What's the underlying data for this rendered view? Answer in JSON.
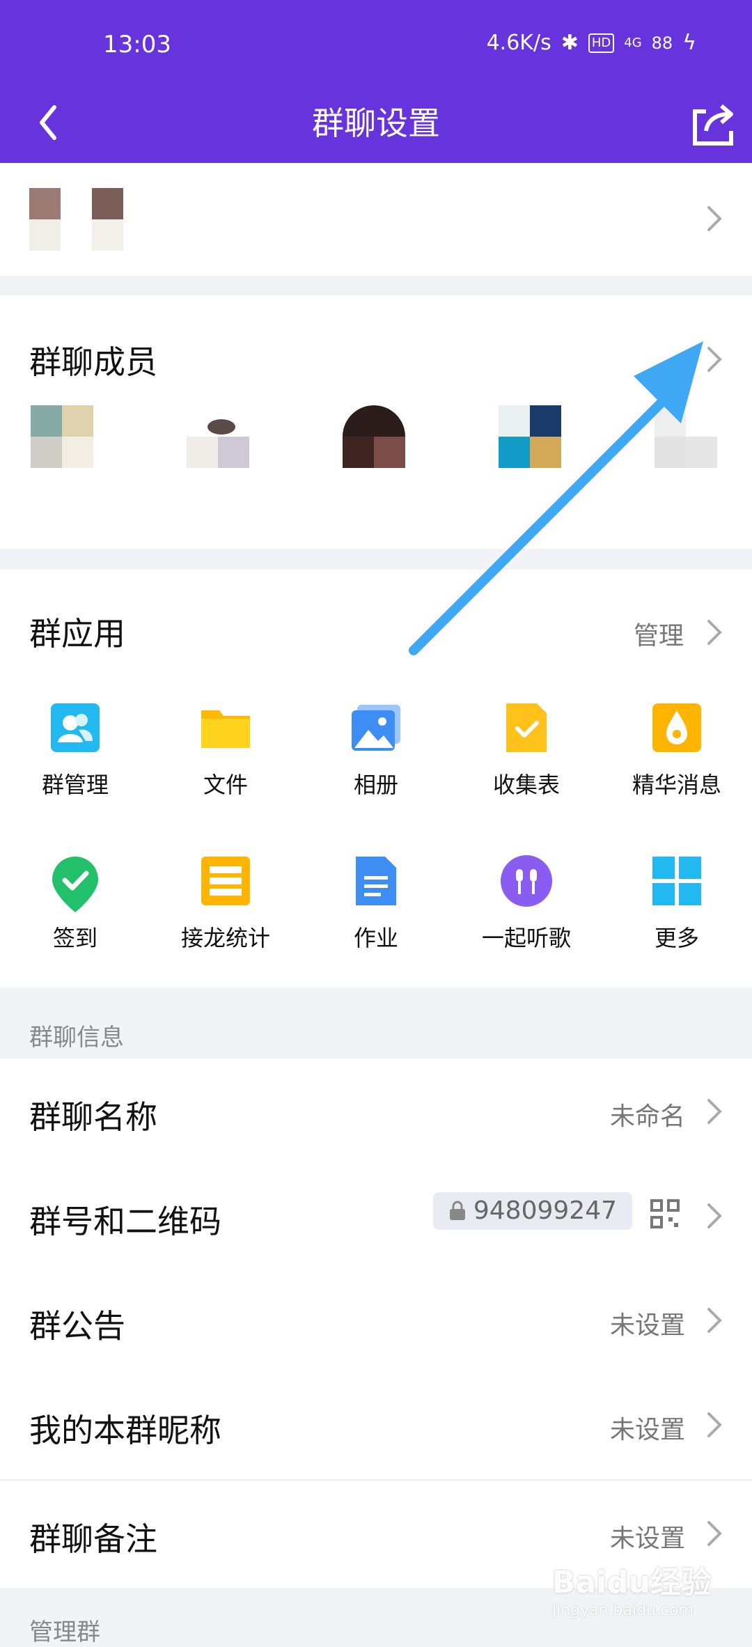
{
  "status_bar": {
    "time": "13:03",
    "speed": "4.6K/s",
    "hd": "HD",
    "network": "4G",
    "battery": "88"
  },
  "nav": {
    "title": "群聊设置",
    "back_icon": "chevron-left-icon",
    "share_icon": "share-icon"
  },
  "members": {
    "title": "群聊成员"
  },
  "apps": {
    "title": "群应用",
    "manage_label": "管理",
    "items": [
      {
        "label": "群管理",
        "icon": "group-manage-icon",
        "color": "#22b8f0"
      },
      {
        "label": "文件",
        "icon": "folder-icon",
        "color": "#ffc21a"
      },
      {
        "label": "相册",
        "icon": "album-icon",
        "color": "#3d8df5"
      },
      {
        "label": "收集表",
        "icon": "form-icon",
        "color": "#ffc21a"
      },
      {
        "label": "精华消息",
        "icon": "essence-icon",
        "color": "#ffb400"
      },
      {
        "label": "签到",
        "icon": "checkin-icon",
        "color": "#22c06a"
      },
      {
        "label": "接龙统计",
        "icon": "solitaire-icon",
        "color": "#ffb400"
      },
      {
        "label": "作业",
        "icon": "homework-icon",
        "color": "#3d8df5"
      },
      {
        "label": "一起听歌",
        "icon": "music-icon",
        "color": "#8a5cf0"
      },
      {
        "label": "更多",
        "icon": "more-grid-icon",
        "color": "#22b8f0"
      }
    ]
  },
  "info": {
    "section_label": "群聊信息",
    "rows": [
      {
        "label": "群聊名称",
        "value": "未命名"
      },
      {
        "label": "群号和二维码",
        "value": "948099247"
      },
      {
        "label": "群公告",
        "value": "未设置"
      },
      {
        "label": "我的本群昵称",
        "value": "未设置"
      },
      {
        "label": "群聊备注",
        "value": "未设置"
      }
    ]
  },
  "manage_section_label": "管理群",
  "watermark": {
    "brand": "Baidu经验",
    "domain": "jingyan.baidu.com"
  },
  "colors": {
    "header": "#6633dd",
    "arrow": "#3fa8f5"
  }
}
